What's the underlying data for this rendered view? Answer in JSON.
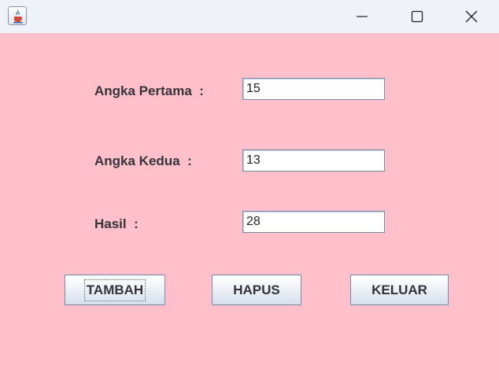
{
  "window": {
    "icon": "java-cup-icon",
    "controls": [
      "minimize-icon",
      "maximize-icon",
      "close-icon"
    ],
    "background_color": "#ffc0cb"
  },
  "form": {
    "first_number_label": "Angka Pertama  :",
    "first_number_value": "15",
    "second_number_label": "Angka Kedua  :",
    "second_number_value": "13",
    "result_label": "Hasil  :",
    "result_value": "28"
  },
  "buttons": {
    "add_label": "TAMBAH",
    "clear_label": "HAPUS",
    "exit_label": "KELUAR"
  }
}
